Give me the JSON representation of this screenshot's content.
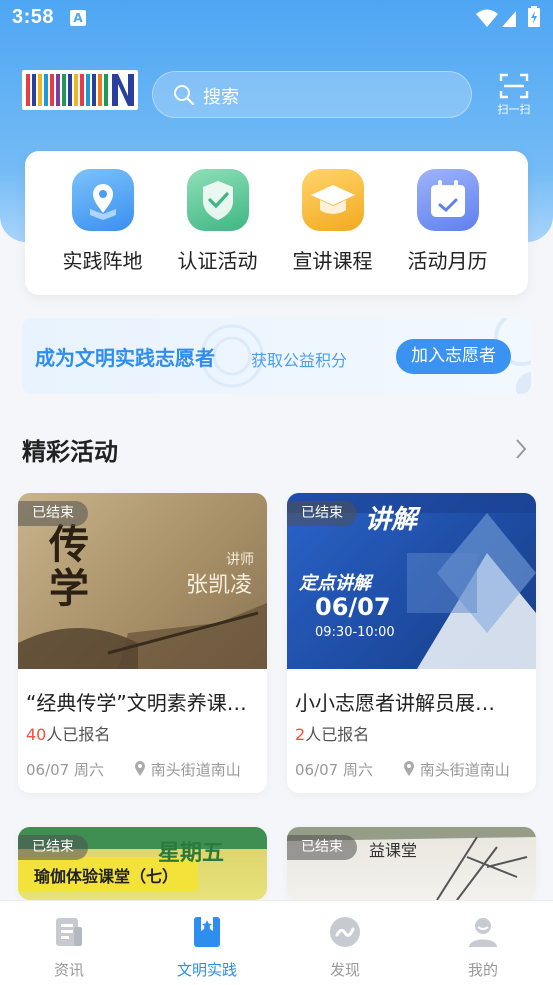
{
  "status": {
    "time": "3:58"
  },
  "header": {
    "search_placeholder": "搜索",
    "scan_label": "扫一扫"
  },
  "quick_entries": [
    {
      "label": "实践阵地",
      "icon": "location-icon",
      "color": "#4a9ef2"
    },
    {
      "label": "认证活动",
      "icon": "shield-check-icon",
      "color": "#46c08d"
    },
    {
      "label": "宣讲课程",
      "icon": "graduation-cap-icon",
      "color": "#f5b431"
    },
    {
      "label": "活动月历",
      "icon": "calendar-icon",
      "color": "#6e8ef0"
    }
  ],
  "banner": {
    "title": "成为文明实践志愿者",
    "subtitle": "获取公益积分",
    "button": "加入志愿者"
  },
  "section": {
    "title": "精彩活动"
  },
  "activities": [
    {
      "badge": "已结束",
      "title": "“经典传学”文明素养课…",
      "signup_count": "40",
      "signup_suffix": "人已报名",
      "date": "06/07 周六",
      "location": "南头街道南山",
      "thumb_text_big": "传学",
      "thumb_text_name": "张凯凌",
      "thumb_text_role": "讲师"
    },
    {
      "badge": "已结束",
      "title": "小小志愿者讲解员展…",
      "signup_count": "2",
      "signup_suffix": "人已报名",
      "date": "06/07 周六",
      "location": "南头街道南山",
      "thumb_text_big": "讲解",
      "thumb_text_sub": "定点讲解",
      "thumb_text_date": "06/07",
      "thumb_text_time": "09:30-10:00"
    },
    {
      "badge": "已结束",
      "thumb_text_big": "星期五",
      "thumb_text_sub": "瑜伽体验课堂（七）"
    },
    {
      "badge": "已结束",
      "thumb_text_sub": "益课堂"
    }
  ],
  "tabbar": [
    {
      "label": "资讯",
      "icon": "news-icon",
      "active": false
    },
    {
      "label": "文明实践",
      "icon": "bookmark-star-icon",
      "active": true
    },
    {
      "label": "发现",
      "icon": "discover-icon",
      "active": false
    },
    {
      "label": "我的",
      "icon": "profile-icon",
      "active": false
    }
  ],
  "colors": {
    "accent": "#2e8ef0",
    "highlight": "#f0533a"
  }
}
